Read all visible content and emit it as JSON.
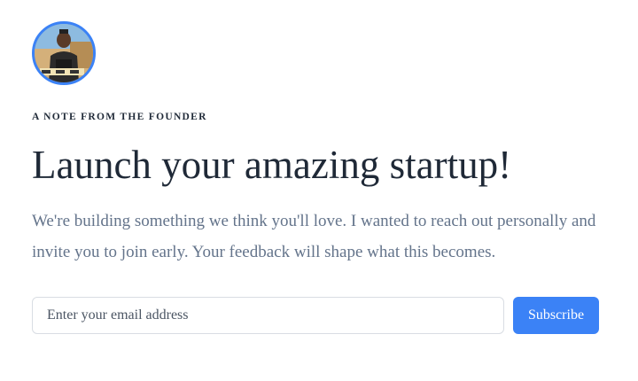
{
  "avatar": {
    "alt": "Founder photo",
    "ring_color": "#3b82f6"
  },
  "eyebrow": "A NOTE FROM THE FOUNDER",
  "headline": "Launch your amazing startup!",
  "lede": "We're building something we think you'll love. I wanted to reach out personally and invite you to join early. Your feedback will shape what this becomes.",
  "form": {
    "email_placeholder": "Enter your email address",
    "email_value": "",
    "subscribe_label": "Subscribe",
    "button_color": "#3b82f6"
  }
}
